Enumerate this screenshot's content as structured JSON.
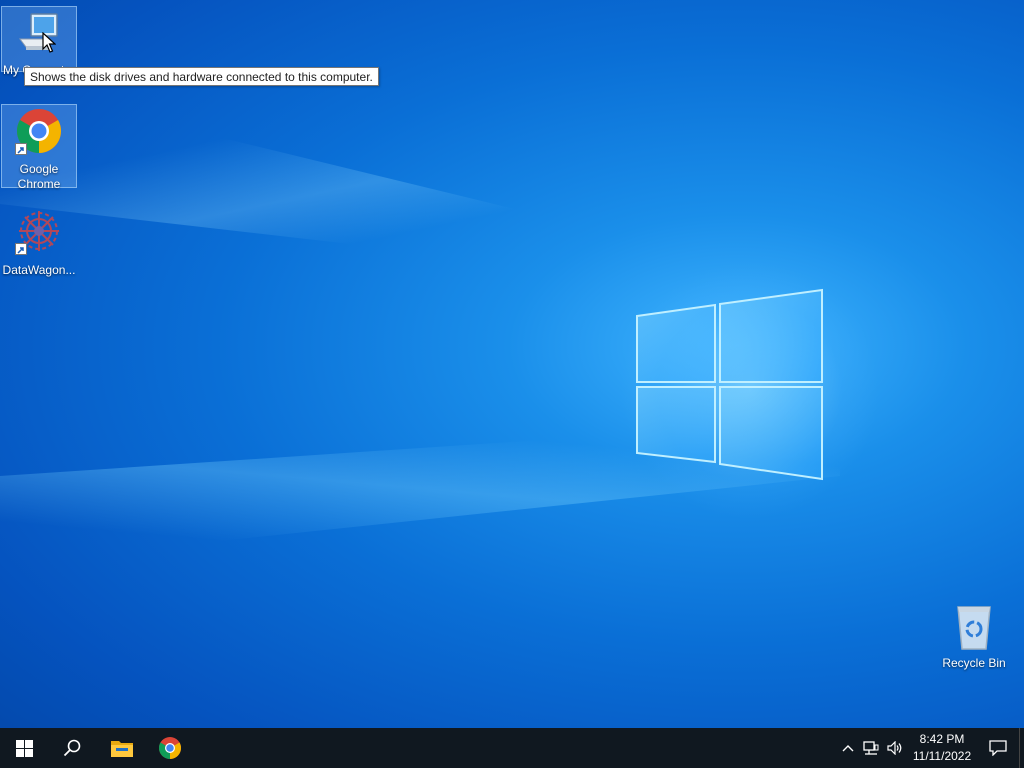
{
  "desktop": {
    "icons": [
      {
        "label": "My Computer",
        "selected": true
      },
      {
        "label": "Google Chrome",
        "selected": true
      },
      {
        "label": "DataWagon..."
      },
      {
        "label": "Recycle Bin"
      }
    ],
    "tooltip": "Shows the disk drives and hardware connected to this computer."
  },
  "taskbar": {
    "start_icon": "windows-start-icon",
    "search_icon": "search-icon",
    "pinned": [
      "file-explorer-icon",
      "chrome-icon"
    ],
    "tray": {
      "icons": [
        "chevron-up-icon",
        "network-icon",
        "volume-icon",
        "notification-icon"
      ],
      "time": "8:42 PM",
      "date": "11/11/2022"
    }
  },
  "colors": {
    "wallpaper_blue": "#0a6fd6",
    "taskbar_bg": "#101820",
    "chrome_red": "#db4437",
    "chrome_green": "#0f9d58",
    "chrome_yellow": "#f4b400",
    "chrome_blue": "#4285f4"
  }
}
